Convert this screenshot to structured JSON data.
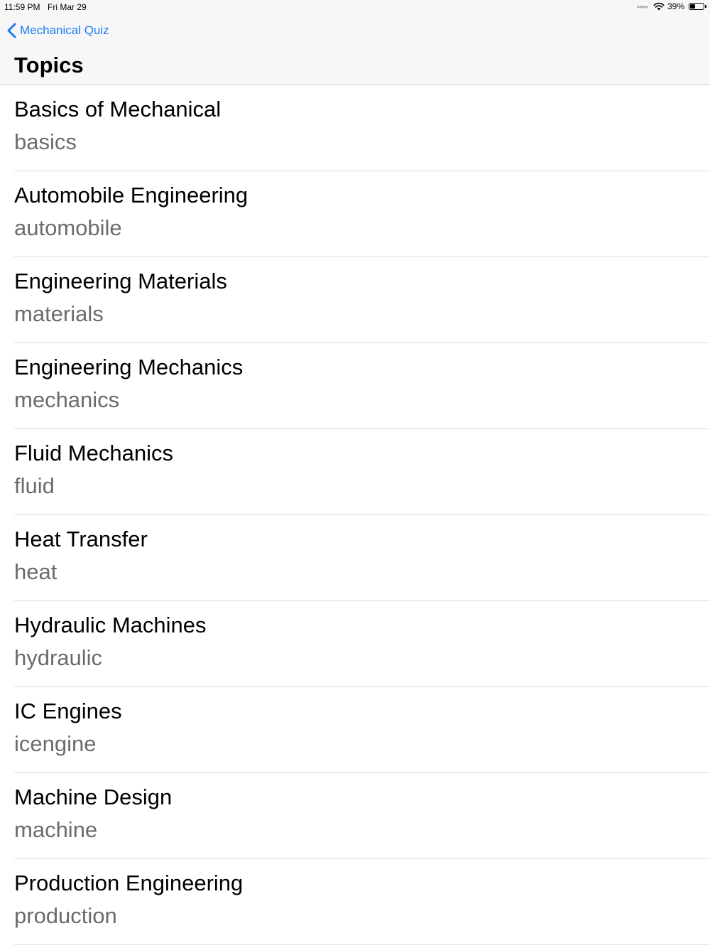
{
  "status_bar": {
    "time": "11:59 PM",
    "date": "Fri Mar 29",
    "battery_percent": "39%",
    "battery_level": 0.39
  },
  "nav": {
    "back_label": "Mechanical Quiz",
    "title": "Topics"
  },
  "topics": [
    {
      "title": "Basics of Mechanical",
      "subtitle": "basics"
    },
    {
      "title": "Automobile Engineering",
      "subtitle": "automobile"
    },
    {
      "title": "Engineering Materials",
      "subtitle": "materials"
    },
    {
      "title": "Engineering Mechanics",
      "subtitle": "mechanics"
    },
    {
      "title": "Fluid Mechanics",
      "subtitle": "fluid"
    },
    {
      "title": "Heat Transfer",
      "subtitle": "heat"
    },
    {
      "title": "Hydraulic Machines",
      "subtitle": "hydraulic"
    },
    {
      "title": "IC Engines",
      "subtitle": "icengine"
    },
    {
      "title": "Machine Design",
      "subtitle": "machine"
    },
    {
      "title": "Production Engineering",
      "subtitle": "production"
    }
  ],
  "colors": {
    "accent": "#1a7cf5",
    "subtitle": "#6b6b6b",
    "separator": "#dcdcde",
    "bar_background": "#f7f7f7"
  },
  "icons": {
    "back": "chevron-left-icon",
    "wifi": "wifi-icon",
    "battery": "battery-icon",
    "signal": "cellular-signal-icon"
  }
}
